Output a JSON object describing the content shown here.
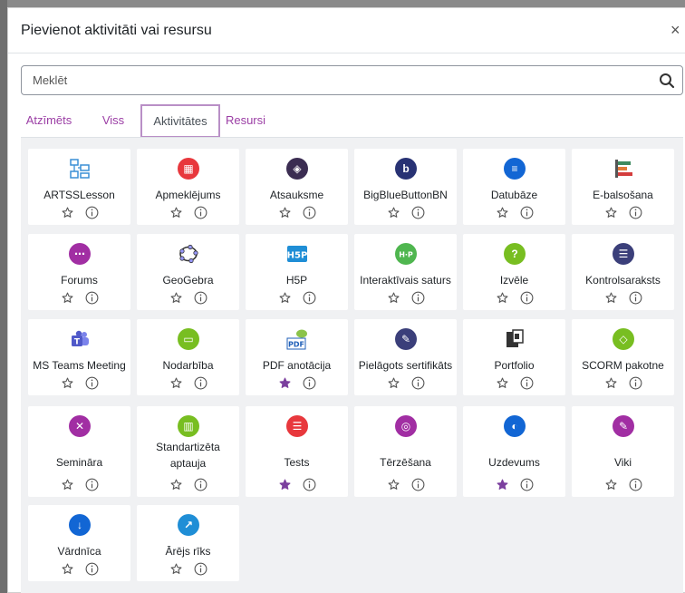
{
  "modal": {
    "title": "Pievienot aktivitāti vai resursu",
    "close_symbol": "×"
  },
  "search": {
    "placeholder": "Meklēt",
    "value": ""
  },
  "tabs": [
    {
      "label": "Atzīmēts",
      "active": false
    },
    {
      "label": "Viss",
      "active": false
    },
    {
      "label": "Aktivitātes",
      "active": true
    },
    {
      "label": "Resursi",
      "active": false
    }
  ],
  "colors": {
    "accent": "#9b3ea5",
    "star_filled": "#7b3f9e",
    "star_outline": "#555555",
    "grid_bg": "#f0f1f3"
  },
  "items": [
    {
      "name": "ARTSSLesson",
      "icon": "lesson-blocks-icon",
      "color": "#3a8fd6",
      "starred": false
    },
    {
      "name": "Apmeklējums",
      "icon": "attendance-icon",
      "color": "#e8383d",
      "starred": false
    },
    {
      "name": "Atsauksme",
      "icon": "feedback-icon",
      "color": "#3b2d52",
      "starred": false
    },
    {
      "name": "BigBlueButtonBN",
      "icon": "bigbluebutton-icon",
      "color": "#283274",
      "starred": false
    },
    {
      "name": "Datubāze",
      "icon": "database-icon",
      "color": "#1266d4",
      "starred": false
    },
    {
      "name": "E-balsošana",
      "icon": "poll-bars-icon",
      "color": "#3d8a5f",
      "starred": false
    },
    {
      "name": "Forums",
      "icon": "forum-icon",
      "color": "#a12ea3",
      "starred": false
    },
    {
      "name": "GeoGebra",
      "icon": "geogebra-icon",
      "color": "#333333",
      "starred": false
    },
    {
      "name": "H5P",
      "icon": "h5p-icon",
      "color": "#1f8ed6",
      "starred": false
    },
    {
      "name": "Interaktīvais saturs",
      "icon": "h5p-interactive-icon",
      "color": "#4fb64f",
      "starred": false
    },
    {
      "name": "Izvēle",
      "icon": "choice-question-icon",
      "color": "#78be21",
      "starred": false
    },
    {
      "name": "Kontrolsaraksts",
      "icon": "checklist-icon",
      "color": "#3b3f7a",
      "starred": false
    },
    {
      "name": "MS Teams Meeting",
      "icon": "ms-teams-icon",
      "color": "#5059c9",
      "starred": false
    },
    {
      "name": "Nodarbība",
      "icon": "lesson-icon",
      "color": "#78be21",
      "starred": false
    },
    {
      "name": "PDF anotācija",
      "icon": "pdf-annotation-icon",
      "color": "#1f5fb8",
      "starred": true
    },
    {
      "name": "Pielāgots sertifikāts",
      "icon": "certificate-icon",
      "color": "#3b3f7a",
      "starred": false
    },
    {
      "name": "Portfolio",
      "icon": "portfolio-icon",
      "color": "#333333",
      "starred": false
    },
    {
      "name": "SCORM pakotne",
      "icon": "scorm-package-icon",
      "color": "#78be21",
      "starred": false
    },
    {
      "name": "Semināra",
      "icon": "workshop-tools-icon",
      "color": "#a12ea3",
      "starred": false
    },
    {
      "name": "Standartizēta aptauja",
      "icon": "survey-chart-icon",
      "color": "#78be21",
      "starred": false
    },
    {
      "name": "Tests",
      "icon": "quiz-list-icon",
      "color": "#e8383d",
      "starred": true
    },
    {
      "name": "Tērzēšana",
      "icon": "chat-bubbles-icon",
      "color": "#a12ea3",
      "starred": false
    },
    {
      "name": "Uzdevums",
      "icon": "assignment-icon",
      "color": "#1266d4",
      "starred": true
    },
    {
      "name": "Viki",
      "icon": "wiki-pencil-icon",
      "color": "#a12ea3",
      "starred": false
    },
    {
      "name": "Vārdnīca",
      "icon": "glossary-sort-icon",
      "color": "#1266d4",
      "starred": false
    },
    {
      "name": "Ārējs rīks",
      "icon": "external-tool-icon",
      "color": "#1f8ed6",
      "starred": false
    }
  ]
}
